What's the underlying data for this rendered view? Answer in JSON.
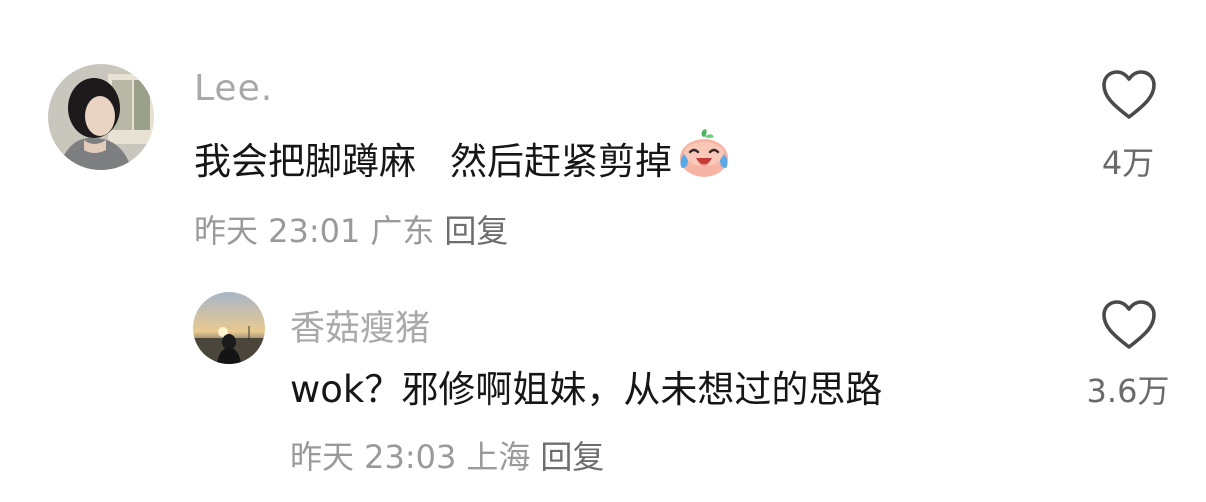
{
  "comments": [
    {
      "username": "Lee.",
      "text_part1": "我会把脚蹲麻",
      "text_part2": "然后赶紧剪掉",
      "emoji_icon": "laughing-tears-peach-icon",
      "time": "昨天 23:01",
      "location": "广东",
      "reply_label": "回复",
      "like_count": "4万"
    },
    {
      "username": "香菇瘦猪",
      "text": "wok？邪修啊姐妹，从未想过的思路",
      "time": "昨天 23:03",
      "location": "上海",
      "reply_label": "回复",
      "like_count": "3.6万"
    }
  ],
  "colors": {
    "username": "#a9a9a9",
    "content": "#161616",
    "meta": "#9a9a9a",
    "like_icon": "#4a4a4a"
  }
}
